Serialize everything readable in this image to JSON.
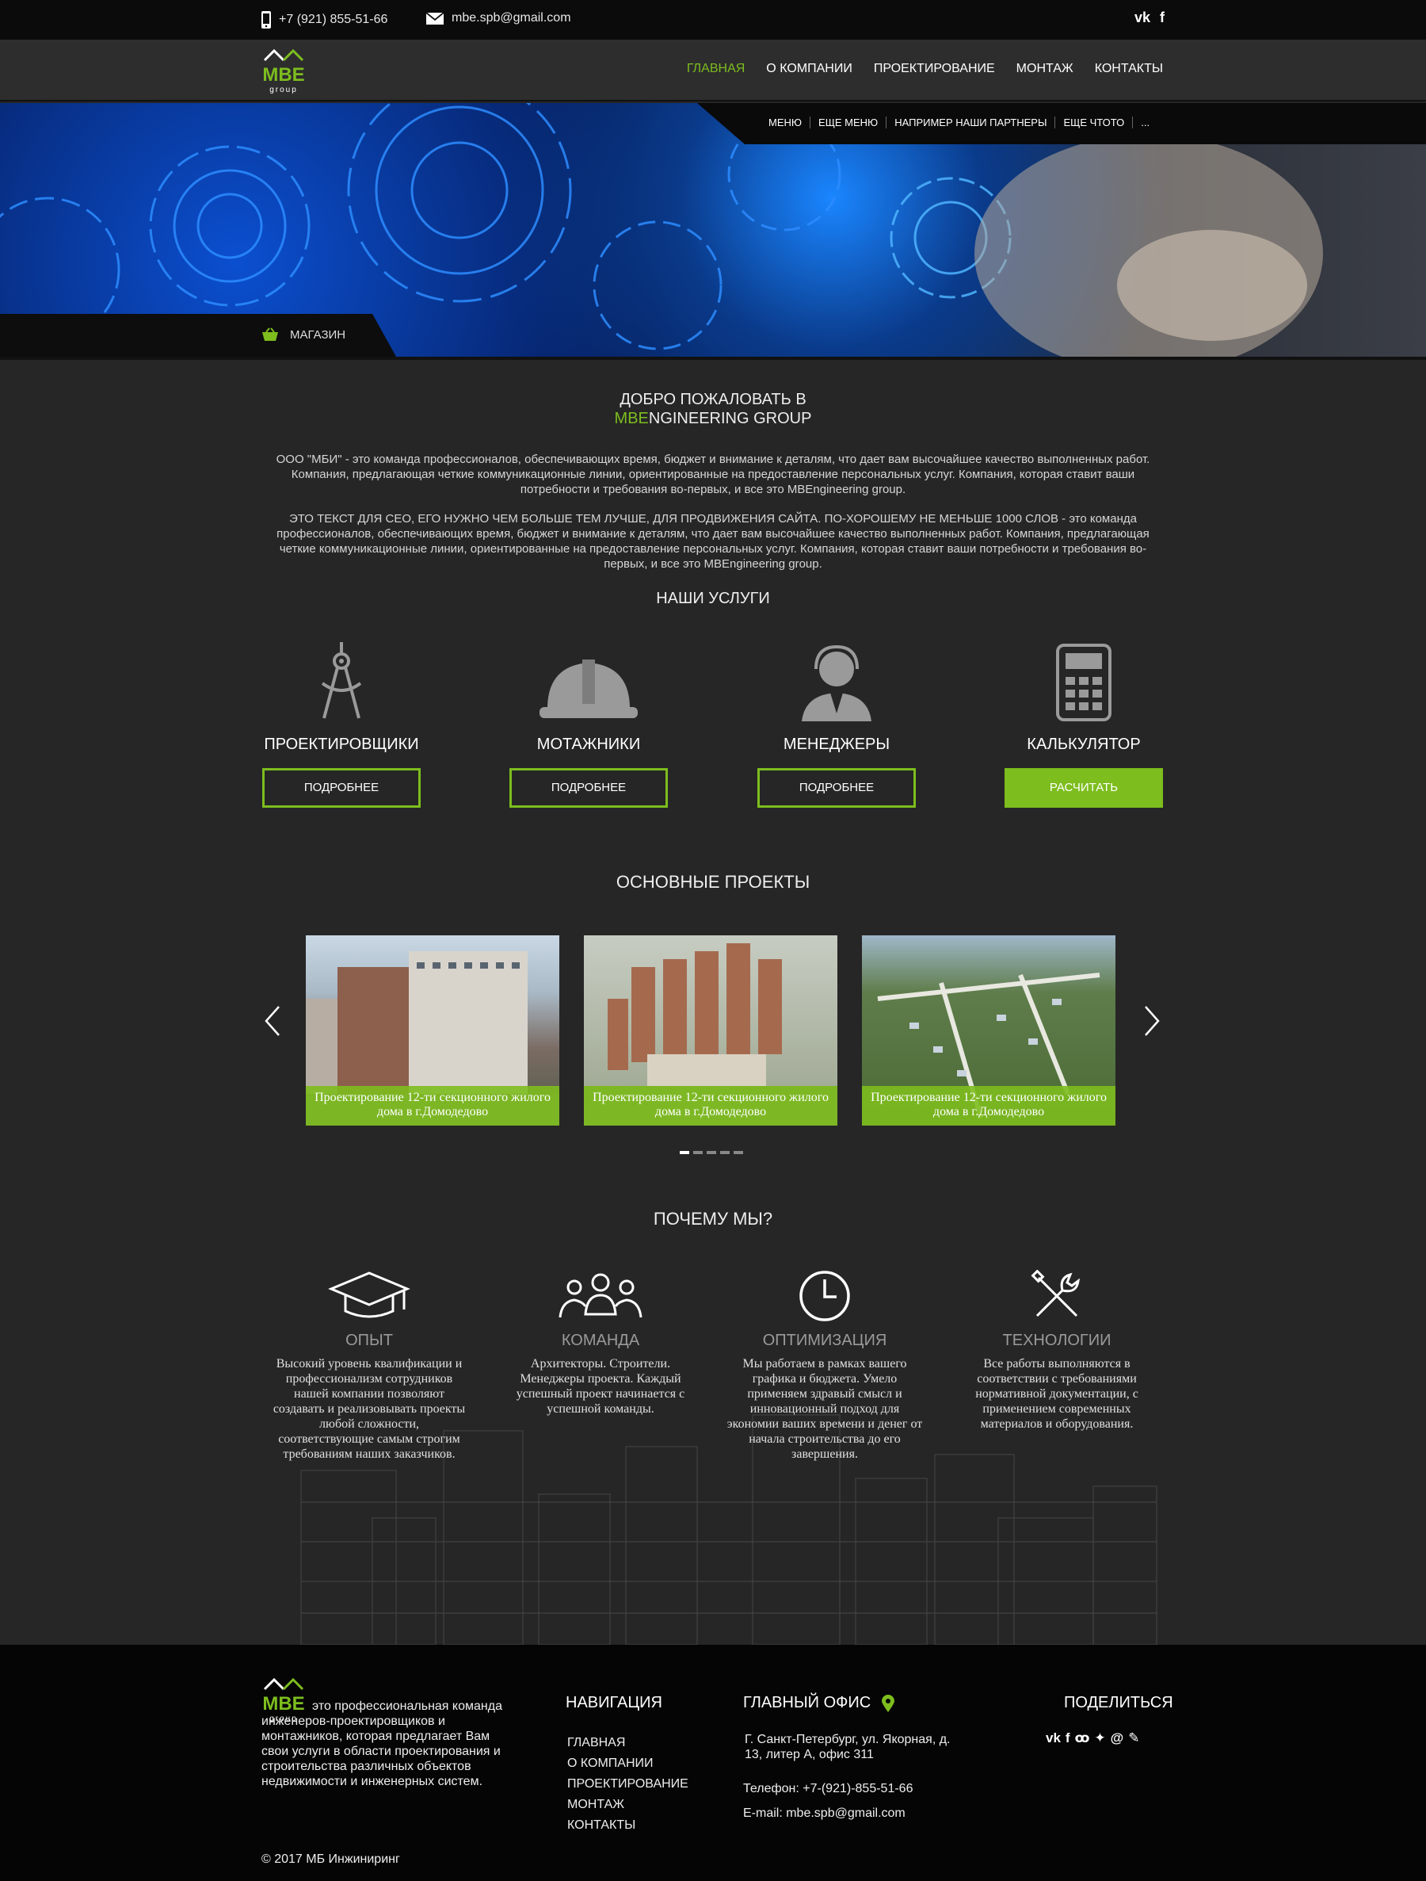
{
  "topbar": {
    "phone": "+7 (921) 855-51-66",
    "email": "mbe.spb@gmail.com",
    "social": [
      "vk-icon",
      "facebook-icon"
    ]
  },
  "logo": {
    "text": "MBE",
    "sub": "group"
  },
  "nav": {
    "items": [
      "ГЛАВНАЯ",
      "О КОМПАНИИ",
      "ПРОЕКТИРОВАНИЕ",
      "МОНТАЖ",
      "КОНТАКТЫ"
    ],
    "active": "ГЛАВНАЯ"
  },
  "submenu": [
    "МЕНЮ",
    "ЕЩЕ МЕНЮ",
    "НАПРИМЕР НАШИ ПАРТНЕРЫ",
    "ЕЩЕ ЧТОТО",
    "..."
  ],
  "shop": {
    "label": "МАГАЗИН"
  },
  "welcome": {
    "line1": "ДОБРО ПОЖАЛОВАТЬ В",
    "brand_green": "MBE",
    "brand_rest": "NGINEERING GROUP",
    "p1": "ООО \"МБИ\" - это команда профессионалов, обеспечивающих время, бюджет и внимание к деталям, что дает вам высочайшее качество выполненных работ. Компания, предлагающая четкие коммуникационные линии, ориентированные на предоставление персональных услуг. Компания, которая ставит ваши потребности и требования во-первых, и все это MBEngineering group.",
    "p2": "ЭТО ТЕКСТ ДЛЯ СЕО, ЕГО НУЖНО ЧЕМ БОЛЬШЕ ТЕМ ЛУЧШЕ, ДЛЯ ПРОДВИЖЕНИЯ САЙТА. ПО-ХОРОШЕМУ НЕ МЕНЬШЕ  1000 СЛОВ - это команда профессионалов, обеспечивающих время, бюджет и внимание к деталям, что дает вам высочайшее качество выполненных работ. Компания, предлагающая четкие коммуникационные линии, ориентированные на предоставление персональных услуг. Компания, которая ставит ваши потребности и требования во-первых, и все это MBEngineering group."
  },
  "services": {
    "title": "НАШИ УСЛУГИ",
    "items": [
      {
        "name": "ПРОЕКТИРОВЩИКИ",
        "button": "ПОДРОБНЕЕ",
        "icon": "compass-icon"
      },
      {
        "name": "МОТАЖНИКИ",
        "button": "ПОДРОБНЕЕ",
        "icon": "hardhat-icon"
      },
      {
        "name": "МЕНЕДЖЕРЫ",
        "button": "ПОДРОБНЕЕ",
        "icon": "headset-manager-icon"
      },
      {
        "name": "КАЛЬКУЛЯТОР",
        "button": "РАСЧИТАТЬ",
        "icon": "calculator-icon"
      }
    ]
  },
  "projects": {
    "title": "ОСНОВНЫЕ ПРОЕКТЫ",
    "items": [
      {
        "caption": "Проектирование 12-ти секционного жилого дома в г.Домодедово"
      },
      {
        "caption": "Проектирование 12-ти секционного жилого дома в г.Домодедово"
      },
      {
        "caption": "Проектирование 12-ти секционного жилого дома в г.Домодедово"
      }
    ],
    "dots": 5,
    "active_dot": 1
  },
  "why": {
    "title": "ПОЧЕМУ МЫ?",
    "items": [
      {
        "name": "ОПЫТ",
        "icon": "graduation-cap-icon",
        "text": "Высокий уровень квалификации и профессионализм сотрудников нашей компании позволяют создавать и реализовывать проекты любой сложности, соответствующие самым строгим требованиям наших заказчиков."
      },
      {
        "name": "КОМАНДА",
        "icon": "team-icon",
        "text": "Архитекторы. Строители. Менеджеры проекта. Каждый успешный проект начинается с успешной команды."
      },
      {
        "name": "ОПТИМИЗАЦИЯ",
        "icon": "clock-icon",
        "text": "Мы работаем в рамках вашего графика и бюджета. Умело применяем здравый смысл и инновационный подход для экономии ваших времени и денег от начала строительства до его завершения."
      },
      {
        "name": "ТЕХНОЛОГИИ",
        "icon": "tools-icon",
        "text": "Все работы выполняются в соответствии с требованиями нормативной документации, с применением современных материалов и оборудования."
      }
    ]
  },
  "footer": {
    "about": "это профессиональная команда инженеров-проектировщиков и монтажников, которая предлагает Вам свои услуги в области проектирования и строительства различных объектов недвижимости и инженерных систем.",
    "nav_title": "НАВИГАЦИЯ",
    "nav": [
      "ГЛАВНАЯ",
      "О КОМПАНИИ",
      "ПРОЕКТИРОВАНИЕ",
      "МОНТАЖ",
      "КОНТАКТЫ"
    ],
    "office_title": "ГЛАВНЫЙ ОФИС",
    "address": "Г. Санкт-Петербург, ул. Якорная, д. 13, литер А, офис 311",
    "phone": "Телефон: +7-(921)-855-51-66",
    "email": "E-mail: mbe.spb@gmail.com",
    "share_title": "ПОДЕЛИТЬСЯ",
    "share_icons": [
      "vk-icon",
      "facebook-icon",
      "odnoklassniki-icon",
      "twitter-icon",
      "mail-icon",
      "pin-icon"
    ],
    "copyright": "© 2017 МБ Инжиниринг"
  },
  "colors": {
    "accent": "#7dbd1e",
    "bg": "#262626",
    "footer": "#050505"
  }
}
